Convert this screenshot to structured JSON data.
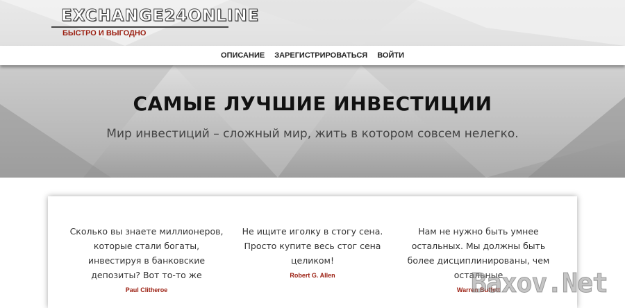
{
  "logo": {
    "title": "EXCHANGE24ONLINE",
    "subtitle": "БЫСТРО И ВЫГОДНО"
  },
  "nav": {
    "items": [
      {
        "label": "ОПИСАНИЕ"
      },
      {
        "label": "ЗАРЕГИСТРИРОВАТЬСЯ"
      },
      {
        "label": "ВОЙТИ"
      }
    ]
  },
  "hero": {
    "title": "САМЫЕ ЛУЧШИЕ ИНВЕСТИЦИИ",
    "subtitle": "Мир инвестиций – сложный мир, жить в котором совсем нелегко."
  },
  "quotes": [
    {
      "text": "Сколько вы знаете миллионеров, которые стали богаты, инвестируя в банковские депозиты? Вот то-то же",
      "author": "Paul Clitheroe"
    },
    {
      "text": "Не ищите иголку в стогу сена. Просто купите весь стог сена целиком!",
      "author": "Robert G. Allen"
    },
    {
      "text": "Нам не нужно быть умнее остальных. Мы должны быть более дисциплинированы, чем остальные",
      "author": "Warren Buffett"
    }
  ],
  "watermark": "Baxov.Net",
  "colors": {
    "accent": "#9a1c0e",
    "text": "#333333",
    "heading": "#111111"
  }
}
